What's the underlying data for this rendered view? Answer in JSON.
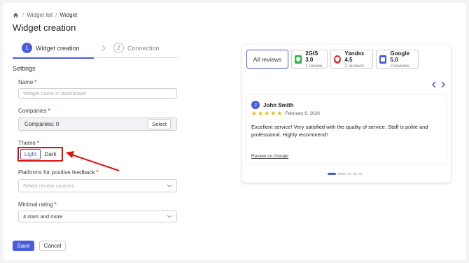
{
  "breadcrumb": {
    "items": [
      "Widget list",
      "Widget"
    ]
  },
  "page": {
    "title": "Widget creation"
  },
  "stepper": {
    "steps": [
      {
        "number": "1",
        "label": "Widget creation"
      },
      {
        "number": "2",
        "label": "Connection"
      }
    ]
  },
  "settings": {
    "title": "Settings",
    "name": {
      "label": "Name",
      "required": "*",
      "placeholder": "Widget name in dashboard"
    },
    "companies": {
      "label": "Companies",
      "required": "*",
      "value": "Companies: 0",
      "select_label": "Select"
    },
    "theme": {
      "label": "Theme",
      "required": "*",
      "options": [
        "Light",
        "Dark"
      ],
      "selected": "Light"
    },
    "platforms": {
      "label": "Platforms for positive feedback",
      "required": "*",
      "placeholder": "Select review sources"
    },
    "rating": {
      "label": "Minimal rating",
      "required": "*",
      "value": "4 stars and more"
    }
  },
  "actions": {
    "save": "Save",
    "cancel": "Cancel"
  },
  "preview": {
    "tabs": [
      {
        "label": "All reviews"
      },
      {
        "name": "2GIS 3.0",
        "count": "1 review",
        "icon": "2gis-logo"
      },
      {
        "name": "Yandex 4.5",
        "count": "2 reviews",
        "icon": "yandex-logo"
      },
      {
        "name": "Google 5.0",
        "count": "2 reviews",
        "icon": "google-logo"
      }
    ],
    "review": {
      "avatar_letter": "J",
      "author": "John Smith",
      "rating": 5,
      "date": "February 6, 2026",
      "text": "Excellent service! Very satisfied with the quality of service. Staff is polite and professional. Highly recommend!",
      "link": "Review on Google"
    },
    "pagination": {
      "active_index": 0
    }
  },
  "colors": {
    "accent": "#4a5bdc",
    "highlight": "#e01010",
    "star": "#f1b600"
  }
}
